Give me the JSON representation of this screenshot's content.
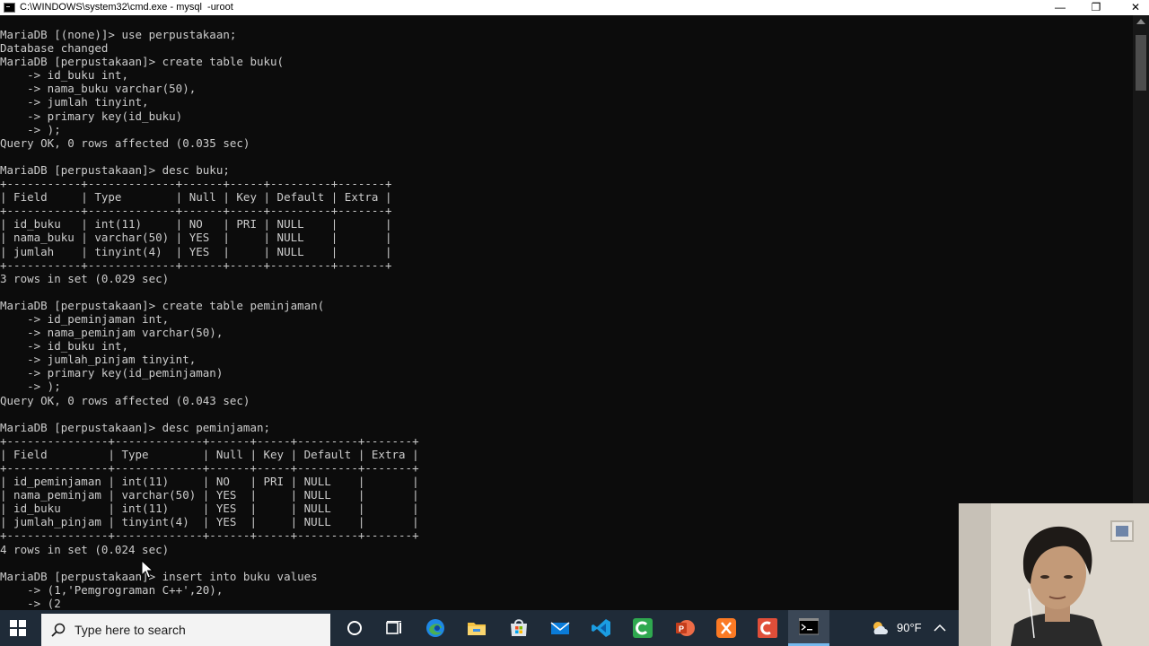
{
  "window": {
    "title": "C:\\WINDOWS\\system32\\cmd.exe - mysql  -uroot",
    "minimize_glyph": "—",
    "restore_glyph": "❐",
    "close_glyph": "✕"
  },
  "terminal_text": "MariaDB [(none)]> use perpustakaan;\nDatabase changed\nMariaDB [perpustakaan]> create table buku(\n    -> id_buku int,\n    -> nama_buku varchar(50),\n    -> jumlah tinyint,\n    -> primary key(id_buku)\n    -> );\nQuery OK, 0 rows affected (0.035 sec)\n\nMariaDB [perpustakaan]> desc buku;\n+-----------+-------------+------+-----+---------+-------+\n| Field     | Type        | Null | Key | Default | Extra |\n+-----------+-------------+------+-----+---------+-------+\n| id_buku   | int(11)     | NO   | PRI | NULL    |       |\n| nama_buku | varchar(50) | YES  |     | NULL    |       |\n| jumlah    | tinyint(4)  | YES  |     | NULL    |       |\n+-----------+-------------+------+-----+---------+-------+\n3 rows in set (0.029 sec)\n\nMariaDB [perpustakaan]> create table peminjaman(\n    -> id_peminjaman int,\n    -> nama_peminjam varchar(50),\n    -> id_buku int,\n    -> jumlah_pinjam tinyint,\n    -> primary key(id_peminjaman)\n    -> );\nQuery OK, 0 rows affected (0.043 sec)\n\nMariaDB [perpustakaan]> desc peminjaman;\n+---------------+-------------+------+-----+---------+-------+\n| Field         | Type        | Null | Key | Default | Extra |\n+---------------+-------------+------+-----+---------+-------+\n| id_peminjaman | int(11)     | NO   | PRI | NULL    |       |\n| nama_peminjam | varchar(50) | YES  |     | NULL    |       |\n| id_buku       | int(11)     | YES  |     | NULL    |       |\n| jumlah_pinjam | tinyint(4)  | YES  |     | NULL    |       |\n+---------------+-------------+------+-----+---------+-------+\n4 rows in set (0.024 sec)\n\nMariaDB [perpustakaan]> insert into buku values\n    -> (1,'Pemgrograman C++',20),\n    -> (2",
  "taskbar": {
    "search_placeholder": "Type here to search",
    "temperature": "90°F",
    "apps": [
      "windows-start-icon",
      "search-icon",
      "cortana-icon",
      "task-view-icon",
      "edge-icon",
      "file-explorer-icon",
      "microsoft-store-icon",
      "mail-icon",
      "visual-studio-code-icon",
      "camtasia-icon",
      "powerpoint-icon",
      "xampp-icon",
      "codeigniter-icon",
      "command-prompt-icon"
    ],
    "tray": [
      "weather-icon",
      "chevron-up-icon"
    ]
  },
  "colors": {
    "terminal_bg": "#0c0c0c",
    "terminal_fg": "#cccccc",
    "taskbar_bg": "#1f2b38",
    "accent": "#76b9ed"
  }
}
